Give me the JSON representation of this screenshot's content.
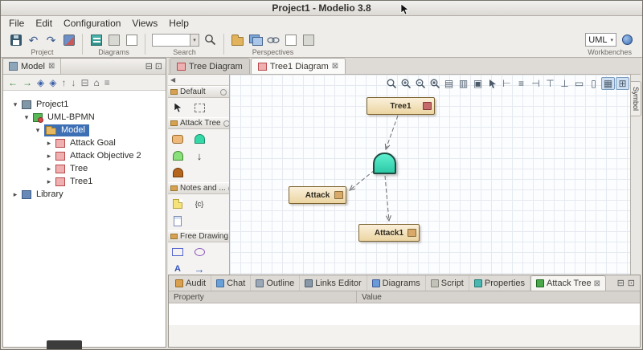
{
  "window": {
    "title": "Project1 - Modelio 3.8"
  },
  "menubar": {
    "items": [
      "File",
      "Edit",
      "Configuration",
      "Views",
      "Help"
    ]
  },
  "toolbar": {
    "project_label": "Project",
    "diagrams_label": "Diagrams",
    "search_label": "Search",
    "perspectives_label": "Perspectives",
    "workbenches_label": "Workbenches",
    "search_value": "",
    "workbench_selected": "UML"
  },
  "model_panel": {
    "tab_label": "Model",
    "tree": [
      {
        "label": "Project1"
      },
      {
        "label": "UML-BPMN"
      },
      {
        "label": "Model"
      },
      {
        "label": "Attack Goal"
      },
      {
        "label": "Attack Objective 2"
      },
      {
        "label": "Tree"
      },
      {
        "label": "Tree1"
      },
      {
        "label": "Library"
      }
    ]
  },
  "editor": {
    "tabs": [
      {
        "label": "Tree Diagram"
      },
      {
        "label": "Tree1 Diagram"
      }
    ],
    "side_tab": "Symbol",
    "palette": {
      "sections": [
        {
          "title": "Default"
        },
        {
          "title": "Attack Tree"
        },
        {
          "title": "Notes and ..."
        },
        {
          "title": "Free Drawing"
        }
      ]
    }
  },
  "diagram": {
    "nodes": [
      {
        "label": "Tree1"
      },
      {
        "label": "Attack"
      },
      {
        "label": "Attack1"
      }
    ]
  },
  "bottom_panel": {
    "tabs": [
      {
        "label": "Audit"
      },
      {
        "label": "Chat"
      },
      {
        "label": "Outline"
      },
      {
        "label": "Links Editor"
      },
      {
        "label": "Diagrams"
      },
      {
        "label": "Script"
      },
      {
        "label": "Properties"
      },
      {
        "label": "Attack Tree"
      }
    ],
    "columns": {
      "property": "Property",
      "value": "Value"
    }
  },
  "glyphs": {
    "expanded": "▾",
    "collapsed": "▸",
    "frame_close": "⊠",
    "min_btn": "⊟",
    "max_btn": "⊡",
    "combo_arrow": "▾",
    "undo": "↶",
    "redo": "↷",
    "nav_back": "←",
    "nav_forward": "→",
    "nav_up": "↑",
    "nav_down": "↓",
    "nav_diamond_l": "◈",
    "nav_diamond_r": "◈",
    "collapse_all": "⊟",
    "home": "⌂",
    "tree_settings": "≡",
    "palette_collapse": "◀",
    "constraint_tool": "{c}",
    "text_tool": "A",
    "arrow_tool": "→",
    "transfer_tool": "↓",
    "dt_print": "▤",
    "dt_save": "▥",
    "dt_camera": "▣",
    "dt_align_left": "⊢",
    "dt_align_center": "≡",
    "dt_align_right": "⊣",
    "dt_align_top": "⊤",
    "dt_align_bottom": "⊥",
    "dt_same_width": "▭",
    "dt_same_height": "▯",
    "dt_grid": "▦",
    "dt_snap": "⊞"
  },
  "colors": {
    "selection": "#3d6fb5",
    "node_fill": "#ecd5a2",
    "gate_fill": "#3ee6c3"
  }
}
